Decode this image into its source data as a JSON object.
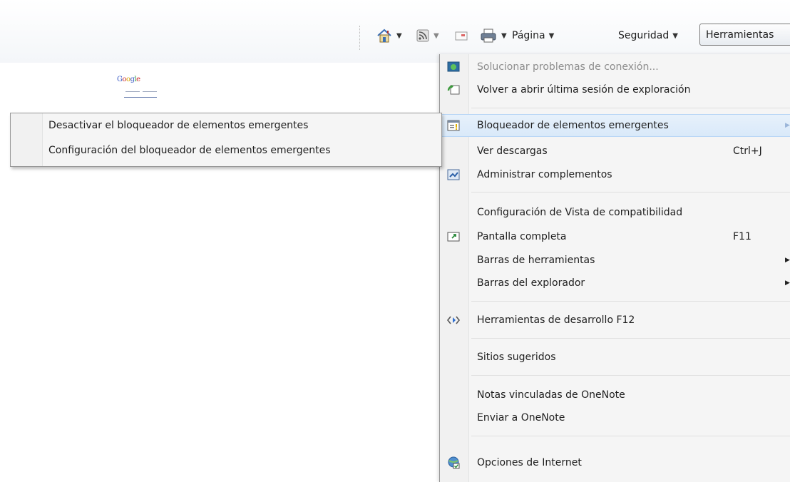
{
  "toolbar": {
    "home_icon": "home-icon",
    "feeds_icon": "rss-feed-icon",
    "mail_icon": "read-mail-icon",
    "print_icon": "printer-icon",
    "page_label": "Página",
    "safety_label": "Seguridad",
    "tools_label": "Herramientas"
  },
  "page": {
    "google_text": "Google"
  },
  "menu": {
    "items": [
      {
        "label": "Solucionar problemas de conexión...",
        "icon": "connection-troubleshoot-icon"
      },
      {
        "label": "Volver a abrir última sesión de exploración",
        "icon": "reopen-session-icon"
      },
      {
        "label": "Bloqueador de elementos emergentes",
        "icon": "popup-blocker-icon"
      },
      {
        "label": "Ver descargas",
        "shortcut": "Ctrl+J"
      },
      {
        "label": "Administrar complementos",
        "icon": "manage-addons-icon"
      },
      {
        "label": "Configuración de Vista de compatibilidad"
      },
      {
        "label": "Pantalla completa",
        "shortcut": "F11",
        "icon": "fullscreen-icon"
      },
      {
        "label": "Barras de herramientas"
      },
      {
        "label": "Barras del explorador"
      },
      {
        "label": "Herramientas de desarrollo F12",
        "icon": "developer-tools-icon"
      },
      {
        "label": "Sitios sugeridos"
      },
      {
        "label": "Notas vinculadas de OneNote"
      },
      {
        "label": "Enviar a OneNote"
      },
      {
        "label": "Opciones de Internet",
        "icon": "internet-options-icon"
      }
    ]
  },
  "submenu": {
    "items": [
      {
        "label": "Desactivar el bloqueador de elementos emergentes"
      },
      {
        "label": "Configuración del bloqueador de elementos emergentes"
      }
    ]
  },
  "colors": {
    "menu_bg": "#f5f5f5",
    "highlight": "#d9e9f9",
    "disabled_text": "#8d8d8d"
  }
}
